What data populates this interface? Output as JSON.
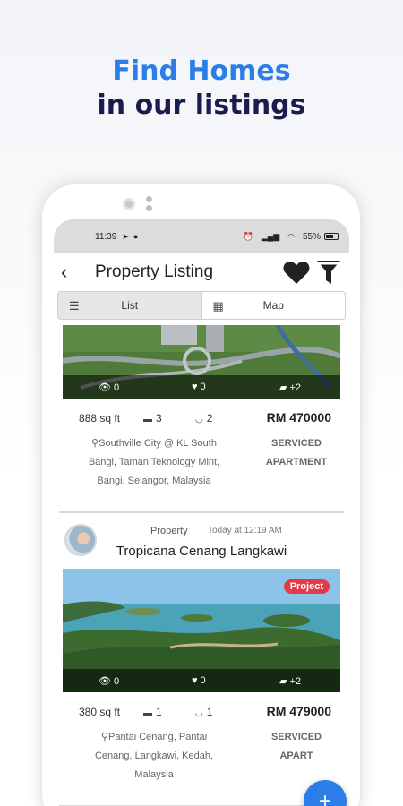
{
  "promo": {
    "line1": "Find Homes",
    "line2": "in our listings"
  },
  "status_bar": {
    "time": "11:39",
    "battery": "55%"
  },
  "app_bar": {
    "title": "Property Listing",
    "back_icon": "back-arrow-icon",
    "favorite_icon": "heart-icon",
    "filter_icon": "filter-funnel-icon"
  },
  "view_toggle": [
    {
      "label": "List",
      "icon": "list-icon",
      "active": true
    },
    {
      "label": "Map",
      "icon": "map-icon",
      "active": false
    }
  ],
  "listings": [
    {
      "views": "0",
      "likes": "0",
      "photos": "+2",
      "area": "888 sq ft",
      "beds": "3",
      "baths": "2",
      "price": "RM 470000",
      "address": [
        "Southville City @ KL South",
        "Bangi, Taman Teknology Mint,",
        "Bangi, Selangor, Malaysia"
      ],
      "type": [
        "SERVICED",
        "APARTMENT"
      ]
    },
    {
      "category": "Property",
      "posted": "Today at 12:19 AM",
      "title": "Tropicana Cenang Langkawi",
      "badge": "Project",
      "views": "0",
      "likes": "0",
      "photos": "+2",
      "area": "380 sq ft",
      "beds": "1",
      "baths": "1",
      "price": "RM 479000",
      "address": [
        "Pantai Cenang, Pantai",
        "Cenang, Langkawi, Kedah,",
        "Malaysia"
      ],
      "type": [
        "SERVICED",
        "APART"
      ]
    }
  ],
  "fab": {
    "label": "+"
  },
  "colors": {
    "accent": "#2b7de9",
    "heading_dark": "#1a1c4e",
    "badge": "#e63946"
  }
}
